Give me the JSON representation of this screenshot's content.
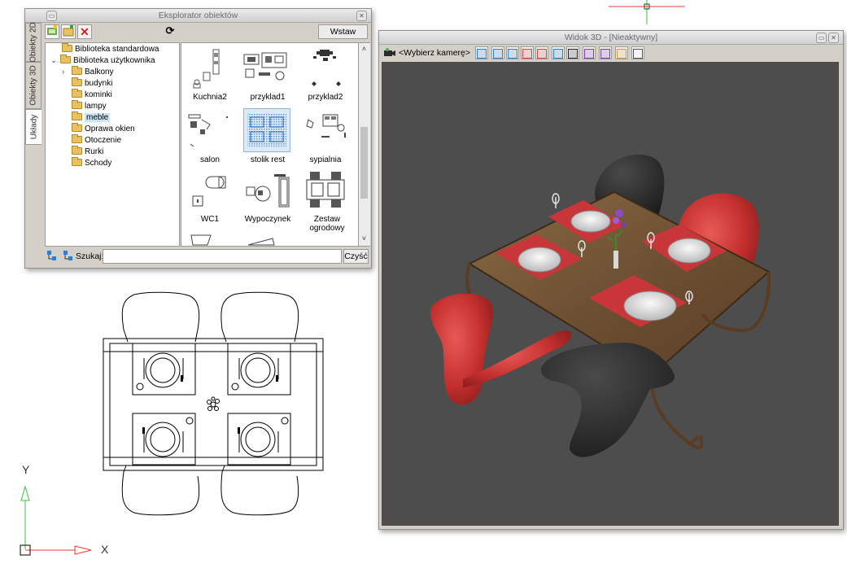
{
  "explorer": {
    "title": "Eksplorator obiektów",
    "insert_button": "Wstaw",
    "side_tabs": [
      "Obiekty 2D",
      "Obiekty 3D",
      "Układy"
    ],
    "tree": [
      {
        "label": "Biblioteka standardowa"
      },
      {
        "label": "Biblioteka użytkownika"
      },
      {
        "label": "Balkony"
      },
      {
        "label": "budynki"
      },
      {
        "label": "kominki"
      },
      {
        "label": "lampy"
      },
      {
        "label": "meble"
      },
      {
        "label": "Oprawa okien"
      },
      {
        "label": "Otoczenie"
      },
      {
        "label": "Rurki"
      },
      {
        "label": "Schody"
      }
    ],
    "thumbnails": [
      {
        "label": "Kuchnia2"
      },
      {
        "label": "przyklad1"
      },
      {
        "label": "przyklad2"
      },
      {
        "label": "salon"
      },
      {
        "label": "stolik rest"
      },
      {
        "label": "sypialnia"
      },
      {
        "label": "WC1"
      },
      {
        "label": "Wypoczynek"
      },
      {
        "label": "Zestaw ogrodowy"
      }
    ],
    "search_label": "Szukaj:",
    "search_value": "",
    "clear_button": "Czyść"
  },
  "view3d": {
    "title": "Widok 3D - [Nieaktywny]",
    "camera_select": "<Wybierz kamerę>",
    "toolbar_icons": [
      "camera-icon",
      "bulb-icon",
      "box-view-icon",
      "box-edges-icon",
      "palette-icon",
      "texture-icon",
      "orbit-icon",
      "walk-icon",
      "render-icon",
      "render-region-icon",
      "settings-icon",
      "3d-icon"
    ]
  },
  "drawing": {
    "axis_x": "X",
    "axis_y": "Y"
  },
  "colors": {
    "accent": "#1874d4",
    "axis": "#ff3030",
    "axis_y": "#38c038",
    "viewport_bg": "#4d4d4d"
  }
}
